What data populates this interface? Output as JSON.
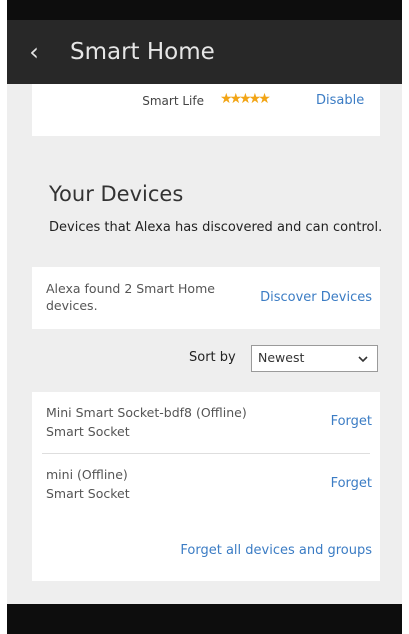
{
  "header": {
    "back_icon": "chevron-left-icon",
    "back_glyph": "‹",
    "title": "Smart Home"
  },
  "skill": {
    "name": "Smart Life",
    "stars": "★★★★★",
    "rating": 4.5,
    "star_color": "#f2a516",
    "disable_label": "Disable"
  },
  "devices_section": {
    "title": "Your Devices",
    "description": "Devices that Alexa has discovered and can control."
  },
  "discover": {
    "message": "Alexa found 2 Smart Home devices.",
    "button_label": "Discover Devices"
  },
  "sort": {
    "label": "Sort by",
    "selected": "Newest"
  },
  "device_list": [
    {
      "name": "Mini Smart Socket-bdf8 (Offline)",
      "type": "Smart Socket",
      "action": "Forget"
    },
    {
      "name": "mini (Offline)",
      "type": "Smart Socket",
      "action": "Forget"
    }
  ],
  "forget_all_label": "Forget all devices and groups",
  "colors": {
    "header_bg": "#282828",
    "link": "#3b7cc4",
    "page_bg": "#eeeeee"
  }
}
